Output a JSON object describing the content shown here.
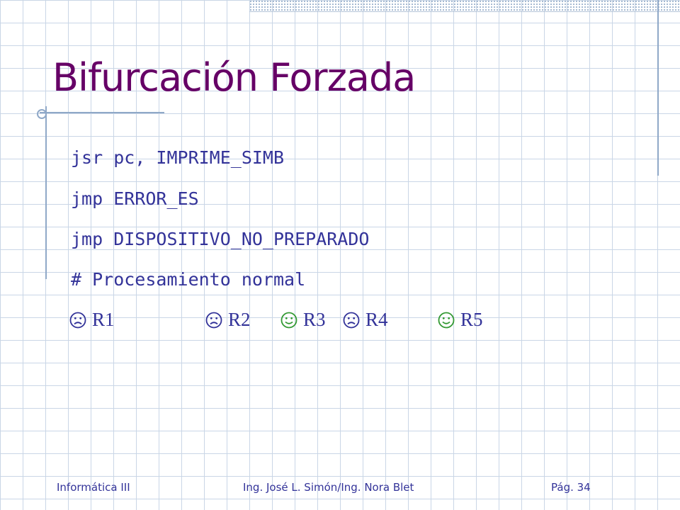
{
  "slide": {
    "title": "Bifurcación Forzada",
    "code_lines": [
      "jsr pc, IMPRIME_SIMB",
      "jmp ERROR_ES",
      "jmp DISPOSITIVO_NO_PREPARADO",
      "# Procesamiento normal"
    ],
    "results": [
      {
        "label": "R1",
        "icon": "frown-face-icon"
      },
      {
        "label": "R2",
        "icon": "frown-face-icon"
      },
      {
        "label": "R3",
        "icon": "smile-face-icon"
      },
      {
        "label": "R4",
        "icon": "frown-face-icon"
      },
      {
        "label": "R5",
        "icon": "smile-face-icon"
      }
    ],
    "colors": {
      "title": "#660066",
      "body": "#333399",
      "frown": "#333399",
      "smile": "#339933",
      "grid": "#c9d6e6"
    }
  },
  "footer": {
    "course": "Informática III",
    "authors": "Ing. José L. Simón/Ing. Nora Blet",
    "page": "Pág. 34"
  }
}
